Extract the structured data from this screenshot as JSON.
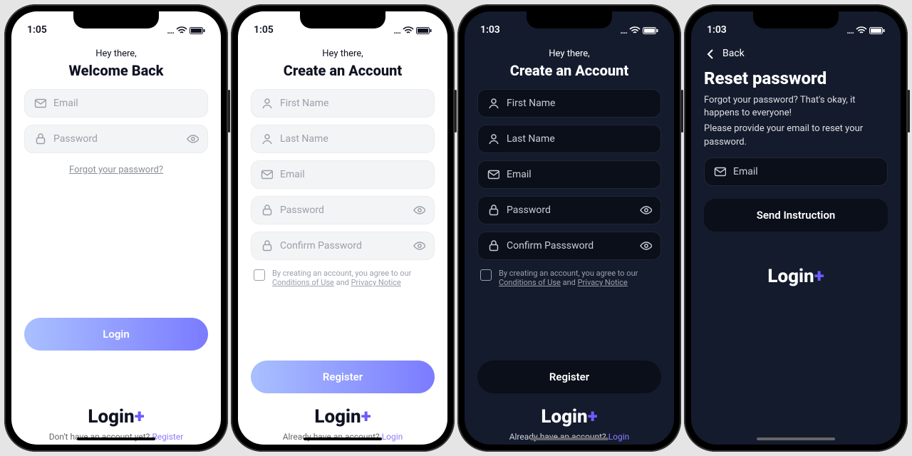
{
  "status": {
    "time_light": "1:05",
    "time_dark": "1:03",
    "dots": "....",
    "wifi": "wifi",
    "battery": "batt"
  },
  "common": {
    "greet": "Hey there,",
    "logo_text": "Login",
    "logo_plus": "+"
  },
  "screen1": {
    "title": "Welcome Back",
    "email_ph": "Email",
    "password_ph": "Password",
    "forgot": "Forgot your password?",
    "login_btn": "Login",
    "hint_text": "Don't have an account yet? ",
    "hint_link": "Register"
  },
  "screen2": {
    "title": "Create an Account",
    "first_ph": "First Name",
    "last_ph": "Last Name",
    "email_ph": "Email",
    "password_ph": "Password",
    "confirm_ph": "Confirm Password",
    "terms_pre": "By creating an account, you agree to our ",
    "terms_cond": "Conditions of Use",
    "terms_and": " and ",
    "terms_priv": "Privacy Notice",
    "register_btn": "Register",
    "hint_text": "Already have an account? ",
    "hint_link": "Login"
  },
  "screen3": {
    "title": "Create an Account",
    "first_ph": "First Name",
    "last_ph": "Last Name",
    "email_ph": "Email",
    "password_ph": "Password",
    "confirm_ph": "Confirm Passsword",
    "terms_pre": "By creating an account, you agree to our ",
    "terms_cond": "Conditions of Use",
    "terms_and": " and ",
    "terms_priv": "Privacy Notice",
    "register_btn": "Register",
    "hint_text": "Already have an account? ",
    "hint_link": "Login"
  },
  "screen4": {
    "back": "Back",
    "title": "Reset password",
    "para1": "Forgot your password? That's okay, it happens to everyone!",
    "para2": "Please provide your email to reset your password.",
    "email_ph": "Email",
    "btn": "Send Instruction"
  }
}
